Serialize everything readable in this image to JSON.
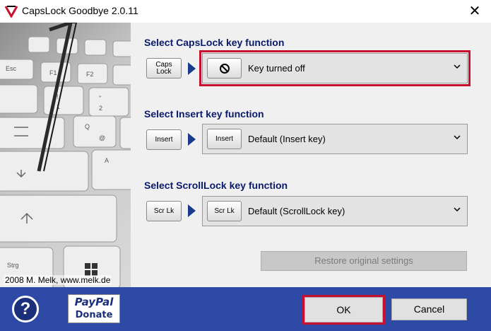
{
  "window": {
    "title": "CapsLock Goodbye 2.0.11",
    "close_glyph": "✕"
  },
  "sidebar": {
    "copyright": "2008 M. Melk, www.melk.de"
  },
  "capslock": {
    "label": "Select CapsLock key function",
    "key_line1": "Caps",
    "key_line2": "Lock",
    "selected_icon": "no-entry-icon",
    "selected_value": "Key turned off"
  },
  "insert": {
    "label": "Select Insert key function",
    "key": "Insert",
    "selected_key": "Insert",
    "selected_value": "Default (Insert key)"
  },
  "scrolllock": {
    "label": "Select ScrollLock key function",
    "key": "Scr Lk",
    "selected_key": "Scr Lk",
    "selected_value": "Default (ScrollLock key)"
  },
  "buttons": {
    "restore": "Restore original settings",
    "help": "?",
    "paypal_line1": "PayPal",
    "paypal_line2": "Donate",
    "ok": "OK",
    "cancel": "Cancel"
  },
  "colors": {
    "footer": "#2e4aa6",
    "highlight": "#c8102e",
    "label_text": "#0a1a6a",
    "arrow": "#1a3a8c"
  }
}
